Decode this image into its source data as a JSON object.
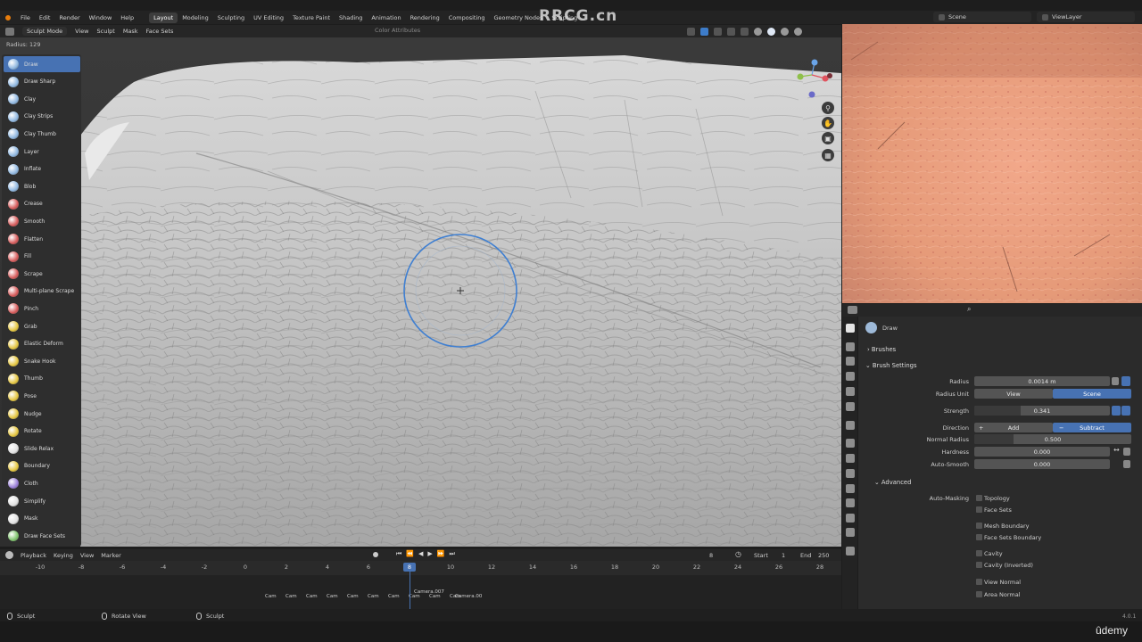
{
  "menu": [
    "File",
    "Edit",
    "Render",
    "Window",
    "Help"
  ],
  "workspaces": [
    "Layout",
    "Modeling",
    "Sculpting",
    "UV Editing",
    "Texture Paint",
    "Shading",
    "Animation",
    "Rendering",
    "Compositing",
    "Geometry Nodes",
    "Scripting"
  ],
  "active_workspace": "Layout",
  "scene": "Scene",
  "view_layer": "ViewLayer",
  "viewport_header": {
    "mode": "Sculpt Mode",
    "items": [
      "View",
      "Sculpt",
      "Mask",
      "Face Sets"
    ],
    "color_attributes": "Color Attributes"
  },
  "radius_readout": "Radius: 129",
  "tools": [
    {
      "label": "Draw",
      "color": "#8fb7e0"
    },
    {
      "label": "Draw Sharp",
      "color": "#8fb7e0"
    },
    {
      "label": "Clay",
      "color": "#8fb7e0"
    },
    {
      "label": "Clay Strips",
      "color": "#8fb7e0"
    },
    {
      "label": "Clay Thumb",
      "color": "#8fb7e0"
    },
    {
      "label": "Layer",
      "color": "#8fb7e0"
    },
    {
      "label": "Inflate",
      "color": "#8fb7e0"
    },
    {
      "label": "Blob",
      "color": "#8fb7e0"
    },
    {
      "label": "Crease",
      "color": "#d65a5a"
    },
    {
      "label": "Smooth",
      "color": "#d65a5a"
    },
    {
      "label": "Flatten",
      "color": "#d65a5a"
    },
    {
      "label": "Fill",
      "color": "#d65a5a"
    },
    {
      "label": "Scrape",
      "color": "#d65a5a"
    },
    {
      "label": "Multi-plane Scrape",
      "color": "#d65a5a"
    },
    {
      "label": "Pinch",
      "color": "#d65a5a"
    },
    {
      "label": "Grab",
      "color": "#e5c640"
    },
    {
      "label": "Elastic Deform",
      "color": "#e5c640"
    },
    {
      "label": "Snake Hook",
      "color": "#e5c640"
    },
    {
      "label": "Thumb",
      "color": "#e5c640"
    },
    {
      "label": "Pose",
      "color": "#e5c640"
    },
    {
      "label": "Nudge",
      "color": "#e5c640"
    },
    {
      "label": "Rotate",
      "color": "#e5c640"
    },
    {
      "label": "Slide Relax",
      "color": "#e0e0e0"
    },
    {
      "label": "Boundary",
      "color": "#e5c640"
    },
    {
      "label": "Cloth",
      "color": "#9a7fd8"
    },
    {
      "label": "Simplify",
      "color": "#e0e0e0"
    },
    {
      "label": "Mask",
      "color": "#e0e0e0"
    },
    {
      "label": "Draw Face Sets",
      "color": "#7fc46c"
    }
  ],
  "properties": {
    "brush_name": "Draw",
    "brushes_label": "Brushes",
    "brush_settings_label": "Brush Settings",
    "radius_label": "Radius",
    "radius_value": "0.0014 m",
    "radius_unit_label": "Radius Unit",
    "radius_unit_view": "View",
    "radius_unit_scene": "Scene",
    "strength_label": "Strength",
    "strength_value": "0.341",
    "strength_fraction": 0.341,
    "direction_label": "Direction",
    "direction_add": "Add",
    "direction_subtract": "Subtract",
    "normal_radius_label": "Normal Radius",
    "normal_radius_value": "0.500",
    "hardness_label": "Hardness",
    "hardness_value": "0.000",
    "autosmooth_label": "Auto-Smooth",
    "autosmooth_value": "0.000",
    "advanced_label": "Advanced",
    "automasking_label": "Auto-Masking",
    "automasking_options": [
      "Topology",
      "Face Sets",
      "Mesh Boundary",
      "Face Sets Boundary",
      "Cavity",
      "Cavity (Inverted)",
      "View Normal",
      "Area Normal"
    ]
  },
  "timeline": {
    "menu": [
      "Playback",
      "Keying",
      "View",
      "Marker"
    ],
    "current_frame": "8",
    "frame_display": "8",
    "start_label": "Start",
    "start_value": "1",
    "end_label": "End",
    "end_value": "250",
    "ticks": [
      "-10",
      "-8",
      "-6",
      "-4",
      "-2",
      "0",
      "2",
      "4",
      "6",
      "8",
      "10",
      "12",
      "14",
      "16",
      "18",
      "20",
      "22",
      "24",
      "26",
      "28"
    ],
    "markers": [
      "Cam",
      "Cam",
      "Cam",
      "Cam",
      "Cam",
      "Cam",
      "Cam",
      "Cam",
      "Cam",
      "Cam",
      "Camera.007",
      "Camera.00"
    ]
  },
  "statusbar": {
    "left": "Sculpt",
    "middle": "Rotate View",
    "right": "Sculpt",
    "version": "4.0.1"
  },
  "watermark": "RRCG.cn",
  "branding": "ûdemy"
}
